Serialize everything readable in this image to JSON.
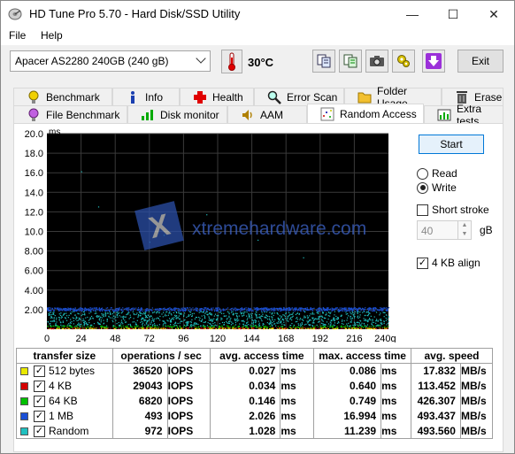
{
  "window": {
    "title": "HD Tune Pro 5.70 - Hard Disk/SSD Utility",
    "minimize": "—",
    "maximize": "☐",
    "close": "✕"
  },
  "menu": {
    "file": "File",
    "help": "Help"
  },
  "toolbar": {
    "drive": "Apacer AS2280 240GB (240 gB)",
    "temperature": "30°C",
    "exit_label": "Exit"
  },
  "tabs_row1": [
    {
      "label": "Benchmark",
      "icon": "benchmark-icon"
    },
    {
      "label": "Info",
      "icon": "info-icon"
    },
    {
      "label": "Health",
      "icon": "health-icon"
    },
    {
      "label": "Error Scan",
      "icon": "error-scan-icon"
    },
    {
      "label": "Folder Usage",
      "icon": "folder-icon"
    },
    {
      "label": "Erase",
      "icon": "erase-icon"
    }
  ],
  "tabs_row2": [
    {
      "label": "File Benchmark",
      "icon": "file-benchmark-icon"
    },
    {
      "label": "Disk monitor",
      "icon": "disk-monitor-icon"
    },
    {
      "label": "AAM",
      "icon": "aam-icon"
    },
    {
      "label": "Random Access",
      "icon": "random-access-icon",
      "active": true
    },
    {
      "label": "Extra tests",
      "icon": "extra-tests-icon"
    }
  ],
  "controls": {
    "start_label": "Start",
    "read_label": "Read",
    "write_label": "Write",
    "mode": "Write",
    "short_stroke_label": "Short stroke",
    "short_stroke_checked": false,
    "short_stroke_value": "40",
    "short_stroke_unit": "gB",
    "align_label": "4 KB align",
    "align_checked": true
  },
  "chart_data": {
    "type": "scatter",
    "ylabel": "ms",
    "ylim": [
      0,
      20
    ],
    "yticks": [
      "20.0",
      "18.0",
      "16.0",
      "14.0",
      "12.0",
      "10.0",
      "8.00",
      "6.00",
      "4.00",
      "2.00"
    ],
    "xlim": [
      0,
      240
    ],
    "xticks": [
      "0",
      "24",
      "48",
      "72",
      "96",
      "120",
      "144",
      "168",
      "192",
      "216",
      "240gB"
    ],
    "series": [
      {
        "name": "512 bytes",
        "color": "#e8e800",
        "level_ms": 0.027
      },
      {
        "name": "4 KB",
        "color": "#d40000",
        "level_ms": 0.034
      },
      {
        "name": "64 KB",
        "color": "#00c000",
        "level_ms": 0.146
      },
      {
        "name": "1 MB",
        "color": "#1a4fd6",
        "level_ms": 2.026
      },
      {
        "name": "Random",
        "color": "#20c0c0",
        "level_ms": 1.028
      }
    ],
    "watermark": "xtremehardware.com"
  },
  "table": {
    "headers": [
      "transfer size",
      "operations / sec",
      "avg. access time",
      "max. access time",
      "avg. speed"
    ],
    "rows": [
      {
        "size": "512 bytes",
        "color": "#e8e800",
        "ops": "36520",
        "ops_unit": "IOPS",
        "avg": "0.027",
        "avg_unit": "ms",
        "max": "0.086",
        "max_unit": "ms",
        "speed": "17.832",
        "speed_unit": "MB/s"
      },
      {
        "size": "4 KB",
        "color": "#d40000",
        "ops": "29043",
        "ops_unit": "IOPS",
        "avg": "0.034",
        "avg_unit": "ms",
        "max": "0.640",
        "max_unit": "ms",
        "speed": "113.452",
        "speed_unit": "MB/s"
      },
      {
        "size": "64 KB",
        "color": "#00c000",
        "ops": "6820",
        "ops_unit": "IOPS",
        "avg": "0.146",
        "avg_unit": "ms",
        "max": "0.749",
        "max_unit": "ms",
        "speed": "426.307",
        "speed_unit": "MB/s"
      },
      {
        "size": "1 MB",
        "color": "#1a4fd6",
        "ops": "493",
        "ops_unit": "IOPS",
        "avg": "2.026",
        "avg_unit": "ms",
        "max": "16.994",
        "max_unit": "ms",
        "speed": "493.437",
        "speed_unit": "MB/s"
      },
      {
        "size": "Random",
        "color": "#20c0c0",
        "ops": "972",
        "ops_unit": "IOPS",
        "avg": "1.028",
        "avg_unit": "ms",
        "max": "11.239",
        "max_unit": "ms",
        "speed": "493.560",
        "speed_unit": "MB/s"
      }
    ]
  }
}
